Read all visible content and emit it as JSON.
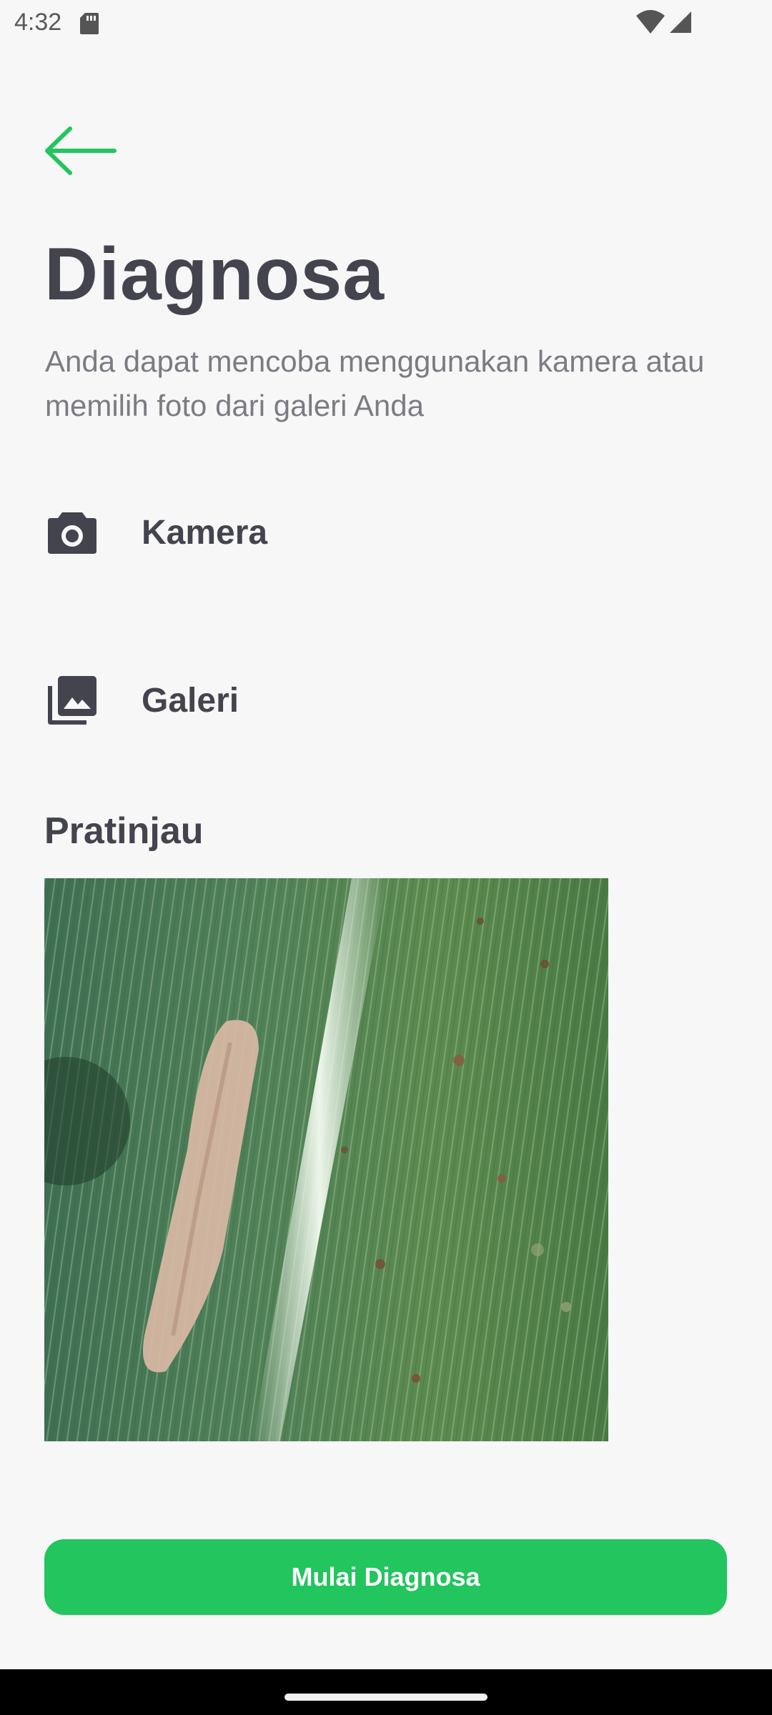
{
  "status_bar": {
    "time": "4:32",
    "sd_icon": "sd-card-icon",
    "wifi_icon": "wifi-icon",
    "signal_icon": "cell-signal-icon"
  },
  "header": {
    "back_icon": "arrow-left-icon",
    "title": "Diagnosa",
    "subtitle": "Anda dapat mencoba menggunakan kamera atau memilih foto dari galeri Anda"
  },
  "options": [
    {
      "label": "Kamera",
      "icon": "camera-icon"
    },
    {
      "label": "Galeri",
      "icon": "photo-library-icon"
    }
  ],
  "preview": {
    "title": "Pratinjau",
    "image": "leaf-photo-preview"
  },
  "actions": {
    "start_label": "Mulai Diagnosa"
  },
  "colors": {
    "accent": "#22c55e",
    "text_primary": "#44444f",
    "text_secondary": "#7b7b83",
    "background": "#f7f7f7"
  }
}
